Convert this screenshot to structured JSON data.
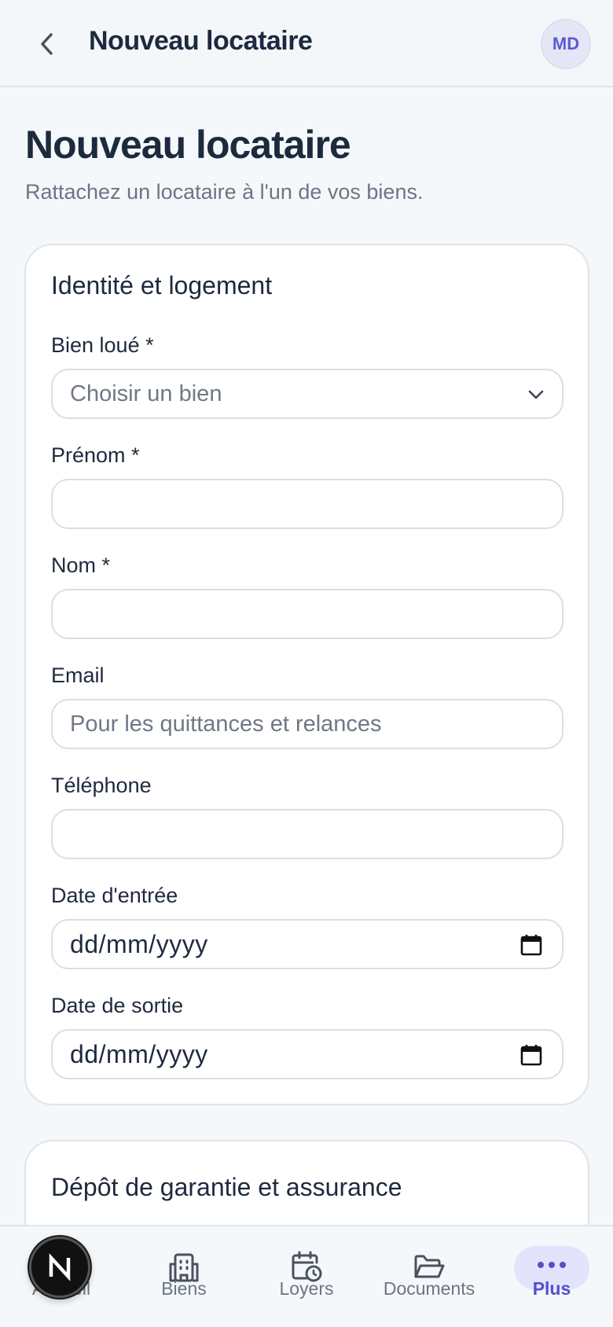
{
  "header": {
    "title": "Nouveau locataire",
    "avatar_initials": "MD"
  },
  "page": {
    "title": "Nouveau locataire",
    "subtitle": "Rattachez un locataire à l'un de vos biens."
  },
  "identity_card": {
    "title": "Identité et logement",
    "fields": {
      "property": {
        "label": "Bien loué *",
        "value": "Choisir un bien"
      },
      "first_name": {
        "label": "Prénom *",
        "value": ""
      },
      "last_name": {
        "label": "Nom *",
        "value": ""
      },
      "email": {
        "label": "Email",
        "placeholder": "Pour les quittances et relances"
      },
      "phone": {
        "label": "Téléphone",
        "value": ""
      },
      "entry_date": {
        "label": "Date d'entrée",
        "value": "dd/mm/yyyy"
      },
      "exit_date": {
        "label": "Date de sortie",
        "value": "dd/mm/yyyy"
      }
    }
  },
  "deposit_card": {
    "title": "Dépôt de garantie et assurance"
  },
  "bottom_nav": {
    "items": [
      {
        "label": "Accueil",
        "icon": "home-icon"
      },
      {
        "label": "Biens",
        "icon": "building-icon"
      },
      {
        "label": "Loyers",
        "icon": "calendar-clock-icon"
      },
      {
        "label": "Documents",
        "icon": "folder-open-icon"
      },
      {
        "label": "Plus",
        "icon": "more-dots-icon",
        "active": true
      }
    ]
  },
  "colors": {
    "accent": "#5150cd",
    "accent_bg": "#e3e4fb",
    "text": "#1f2a3d",
    "muted": "#6b7585"
  }
}
